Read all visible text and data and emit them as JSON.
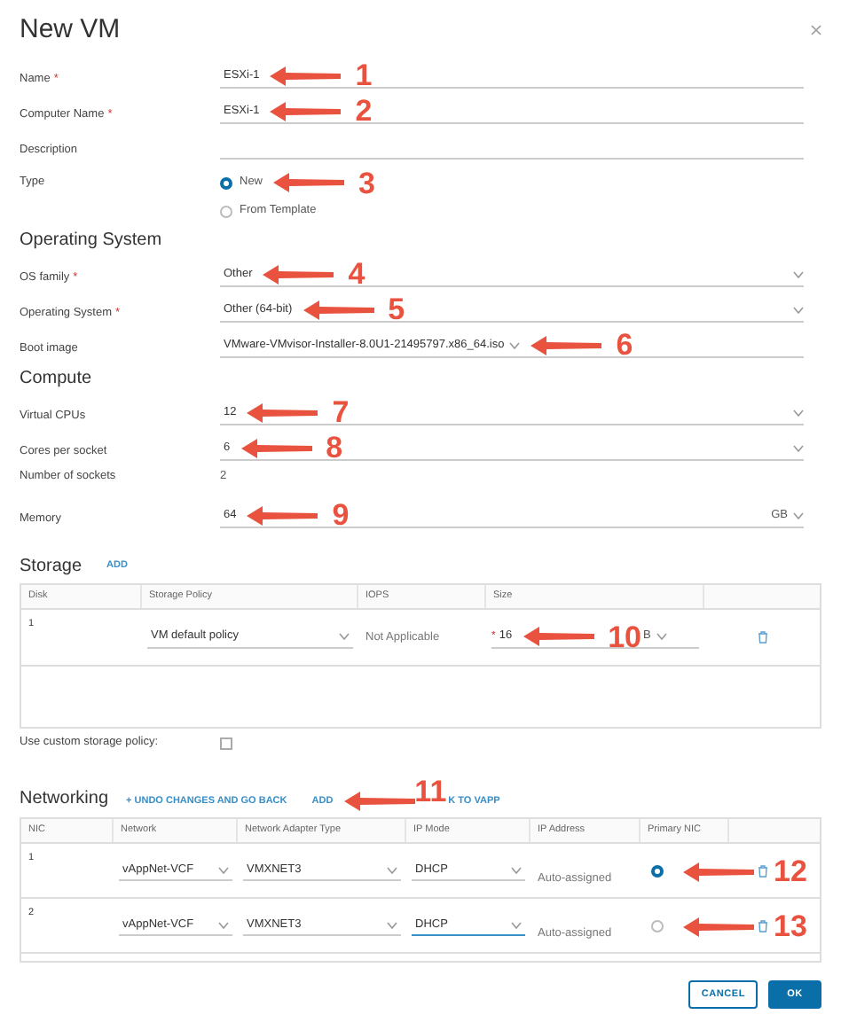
{
  "dialog": {
    "title": "New VM"
  },
  "sections": [
    {
      "fields": [
        {
          "kind": "text",
          "label": "Name",
          "required_mark": "*",
          "value": "ESXi-1",
          "annotation": "1"
        },
        {
          "kind": "text",
          "label": "Computer Name",
          "required_mark": "*",
          "value": "ESXi-1",
          "annotation": "2"
        },
        {
          "kind": "text",
          "label": "Description"
        },
        {
          "kind": "radio",
          "label": "Type",
          "options": [
            {
              "label": "New",
              "selected": true,
              "annotation": "3"
            },
            {
              "label": "From Template",
              "selected": false
            }
          ]
        }
      ]
    },
    {
      "heading": "Operating System",
      "fields": [
        {
          "kind": "select",
          "label": "OS family",
          "required_mark": "*",
          "value": "Other",
          "annotation": "4"
        },
        {
          "kind": "select",
          "label": "Operating System",
          "required_mark": "*",
          "value": "Other (64-bit)",
          "annotation": "5"
        },
        {
          "kind": "inline_select",
          "label": "Boot image",
          "value": "VMware-VMvisor-Installer-8.0U1-21495797.x86_64.iso",
          "annotation": "6"
        }
      ]
    },
    {
      "heading": "Compute",
      "fields": [
        {
          "kind": "select",
          "label": "Virtual CPUs",
          "value": "12",
          "annotation": "7"
        },
        {
          "kind": "select",
          "label": "Cores per socket",
          "value": "6",
          "annotation": "8"
        },
        {
          "kind": "plain",
          "label": "Number of sockets",
          "value": "2"
        },
        {
          "kind": "unit",
          "label": "Memory",
          "value": "64",
          "unit": "GB",
          "annotation": "9"
        }
      ]
    }
  ],
  "storage": {
    "heading": "Storage",
    "add": "ADD",
    "columns": [
      "Disk",
      "Storage Policy",
      "IOPS",
      "Size"
    ],
    "rows": [
      {
        "disk": "1",
        "policy": "VM default policy",
        "iops": "Not Applicable",
        "size_mark": "*",
        "size": "16",
        "annotation": "10",
        "unit": "B"
      }
    ],
    "custom_policy": {
      "label": "Use custom storage policy:",
      "checked": false
    }
  },
  "networking": {
    "heading": "Networking",
    "undo": "+ UNDO CHANGES AND GO BACK",
    "add": "ADD",
    "annotation": "11",
    "cut_link": "K TO VAPP",
    "columns": [
      "NIC",
      "Network",
      "Network Adapter Type",
      "IP Mode",
      "IP Address",
      "Primary NIC"
    ],
    "rows": [
      {
        "nic": "1",
        "network": "vAppNet-VCF",
        "adapter": "VMXNET3",
        "ip_mode": "DHCP",
        "focused": false,
        "ip_address": "Auto-assigned",
        "selected": true,
        "annotation": "12"
      },
      {
        "nic": "2",
        "network": "vAppNet-VCF",
        "adapter": "VMXNET3",
        "ip_mode": "DHCP",
        "focused": true,
        "ip_address": "Auto-assigned",
        "selected": false,
        "annotation": "13"
      }
    ]
  },
  "buttons": [
    {
      "label": "CANCEL",
      "kind": "secondary"
    },
    {
      "label": "OK",
      "kind": "primary"
    }
  ]
}
